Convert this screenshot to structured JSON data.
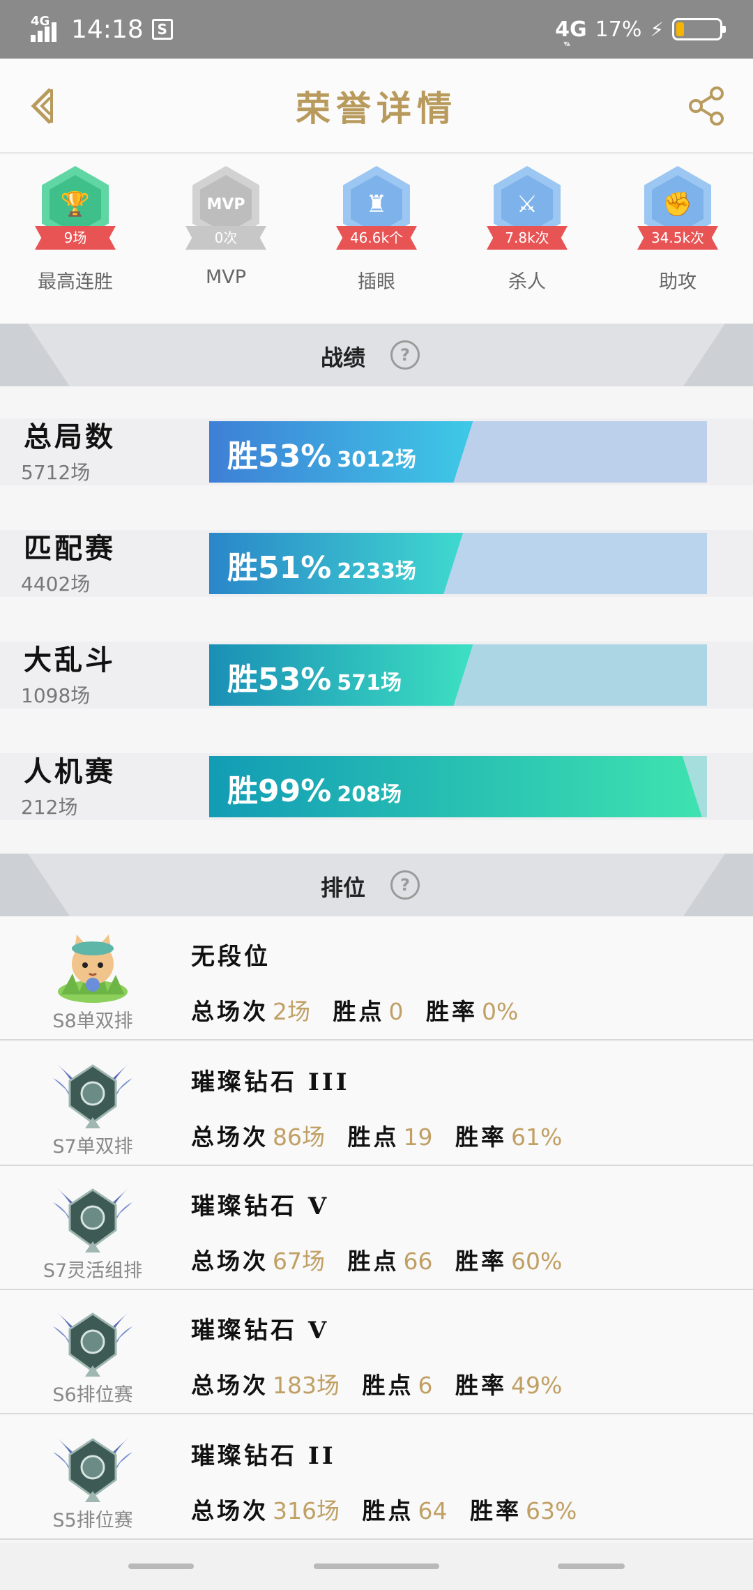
{
  "status_bar": {
    "network": "4G",
    "time": "14:18",
    "notif": "S",
    "network_right": "4G",
    "battery": "17%",
    "battery_level": 0.17
  },
  "header": {
    "title": "荣誉详情"
  },
  "honors": [
    {
      "label": "最高连胜",
      "value": "9场",
      "color": "#5fd6a3",
      "inner": "#3fbf89",
      "icon": "trophy-icon",
      "glyph": "🏆",
      "ribbon": "red"
    },
    {
      "label": "MVP",
      "value": "0次",
      "color": "#d2d2d2",
      "inner": "#bdbdbd",
      "icon": "mvp-icon",
      "glyph": "MVP",
      "ribbon": "gray"
    },
    {
      "label": "插眼",
      "value": "46.6k个",
      "color": "#9cc7f2",
      "inner": "#7eb2ea",
      "icon": "ward-icon",
      "glyph": "♜",
      "ribbon": "red"
    },
    {
      "label": "杀人",
      "value": "7.8k次",
      "color": "#9cc7f2",
      "inner": "#7eb2ea",
      "icon": "kill-icon",
      "glyph": "⚔",
      "ribbon": "red"
    },
    {
      "label": "助攻",
      "value": "34.5k次",
      "color": "#9cc7f2",
      "inner": "#7eb2ea",
      "icon": "assist-icon",
      "glyph": "✊",
      "ribbon": "red"
    }
  ],
  "sections": {
    "record": "战绩",
    "rank": "排位",
    "help": "?"
  },
  "stats": [
    {
      "name": "总局数",
      "total": "5712场",
      "win_label": "胜53%",
      "wins": "3012场",
      "win_rate": 0.53,
      "track": "#bcd0ec",
      "fill_from": "#3e7fd6",
      "fill_to": "#3ec9e6"
    },
    {
      "name": "匹配赛",
      "total": "4402场",
      "win_label": "胜51%",
      "wins": "2233场",
      "win_rate": 0.51,
      "track": "#bad4ee",
      "fill_from": "#2a86c9",
      "fill_to": "#3fd9cf"
    },
    {
      "name": "大乱斗",
      "total": "1098场",
      "win_label": "胜53%",
      "wins": "571场",
      "win_rate": 0.53,
      "track": "#acd6e4",
      "fill_from": "#1a8fb6",
      "fill_to": "#3de0c2"
    },
    {
      "name": "人机赛",
      "total": "212场",
      "win_label": "胜99%",
      "wins": "208场",
      "win_rate": 0.99,
      "track": "#a6dede",
      "fill_from": "#129cb5",
      "fill_to": "#3ee3b0"
    }
  ],
  "ranks": [
    {
      "season": "S8单双排",
      "tier": "无段位",
      "games": "2场",
      "points": "0",
      "winrate": "0%",
      "icon": "cat-rank-icon"
    },
    {
      "season": "S7单双排",
      "tier": "璀璨钻石 III",
      "games": "86场",
      "points": "19",
      "winrate": "61%",
      "icon": "diamond-rank-icon"
    },
    {
      "season": "S7灵活组排",
      "tier": "璀璨钻石 V",
      "games": "67场",
      "points": "66",
      "winrate": "60%",
      "icon": "diamond-rank-icon"
    },
    {
      "season": "S6排位赛",
      "tier": "璀璨钻石 V",
      "games": "183场",
      "points": "6",
      "winrate": "49%",
      "icon": "diamond-rank-icon"
    },
    {
      "season": "S5排位赛",
      "tier": "璀璨钻石 II",
      "games": "316场",
      "points": "64",
      "winrate": "63%",
      "icon": "diamond-rank-icon"
    }
  ],
  "rank_labels": {
    "games": "总场次",
    "points": "胜点",
    "winrate": "胜率"
  }
}
